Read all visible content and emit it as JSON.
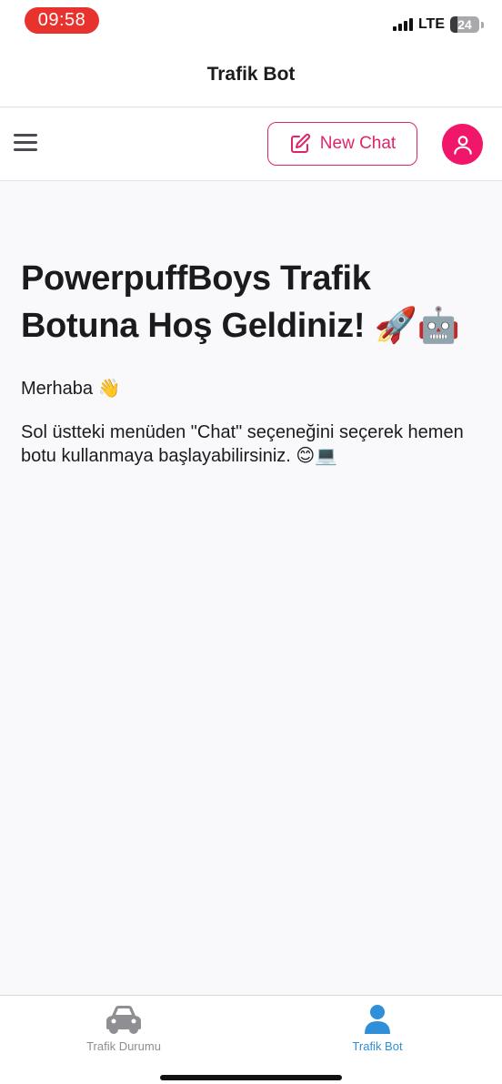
{
  "status_bar": {
    "time": "09:58",
    "network": "LTE",
    "battery": "24",
    "colors": {
      "time_pill": "#e8322d"
    },
    "icons": {
      "signal": "cellular-signal-icon",
      "battery": "battery-icon"
    }
  },
  "header": {
    "title": "Trafik Bot"
  },
  "toolbar": {
    "new_chat_label": "New Chat",
    "icons": {
      "menu": "hamburger-menu-icon",
      "new_chat": "edit-pencil-icon",
      "profile": "user-profile-icon"
    },
    "colors": {
      "accent": "#e0246a",
      "avatar": "#f0176a"
    }
  },
  "main": {
    "welcome": "PowerpuffBoys Trafik Botuna Hoş Geldiniz! 🚀🤖",
    "greeting": "Merhaba 👋",
    "instructions": "Sol üstteki menüden \"Chat\" seçeneğini seçerek hemen botu kullanmaya başlayabilirsiniz. 😊💻"
  },
  "tabs": [
    {
      "label": "Trafik Durumu",
      "icon": "car-icon",
      "active": false
    },
    {
      "label": "Trafik Bot",
      "icon": "person-icon",
      "active": true
    }
  ],
  "colors": {
    "active_tab": "#2f8fd9",
    "inactive_tab": "#8e8e93"
  }
}
